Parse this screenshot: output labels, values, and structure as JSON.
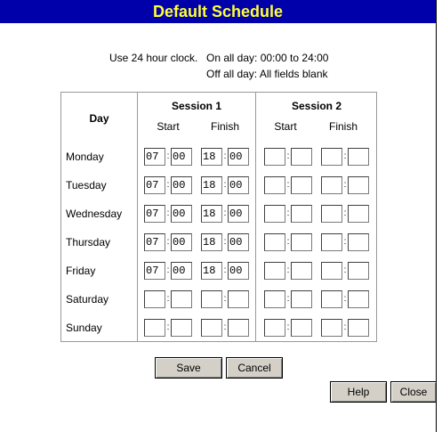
{
  "header": {
    "title": "Default Schedule"
  },
  "notes": {
    "use24": "Use 24 hour clock.",
    "on_all_day": "On all day: 00:00 to 24:00",
    "off_all_day": "Off all day: All fields blank"
  },
  "table": {
    "day_header": "Day",
    "session1": "Session 1",
    "session2": "Session 2",
    "start": "Start",
    "finish": "Finish",
    "rows": [
      {
        "day": "Monday",
        "s1_start_h": "07",
        "s1_start_m": "00",
        "s1_finish_h": "18",
        "s1_finish_m": "00",
        "s2_start_h": "",
        "s2_start_m": "",
        "s2_finish_h": "",
        "s2_finish_m": ""
      },
      {
        "day": "Tuesday",
        "s1_start_h": "07",
        "s1_start_m": "00",
        "s1_finish_h": "18",
        "s1_finish_m": "00",
        "s2_start_h": "",
        "s2_start_m": "",
        "s2_finish_h": "",
        "s2_finish_m": ""
      },
      {
        "day": "Wednesday",
        "s1_start_h": "07",
        "s1_start_m": "00",
        "s1_finish_h": "18",
        "s1_finish_m": "00",
        "s2_start_h": "",
        "s2_start_m": "",
        "s2_finish_h": "",
        "s2_finish_m": ""
      },
      {
        "day": "Thursday",
        "s1_start_h": "07",
        "s1_start_m": "00",
        "s1_finish_h": "18",
        "s1_finish_m": "00",
        "s2_start_h": "",
        "s2_start_m": "",
        "s2_finish_h": "",
        "s2_finish_m": ""
      },
      {
        "day": "Friday",
        "s1_start_h": "07",
        "s1_start_m": "00",
        "s1_finish_h": "18",
        "s1_finish_m": "00",
        "s2_start_h": "",
        "s2_start_m": "",
        "s2_finish_h": "",
        "s2_finish_m": ""
      },
      {
        "day": "Saturday",
        "s1_start_h": "",
        "s1_start_m": "",
        "s1_finish_h": "",
        "s1_finish_m": "",
        "s2_start_h": "",
        "s2_start_m": "",
        "s2_finish_h": "",
        "s2_finish_m": ""
      },
      {
        "day": "Sunday",
        "s1_start_h": "",
        "s1_start_m": "",
        "s1_finish_h": "",
        "s1_finish_m": "",
        "s2_start_h": "",
        "s2_start_m": "",
        "s2_finish_h": "",
        "s2_finish_m": ""
      }
    ]
  },
  "buttons": {
    "save": "Save",
    "cancel": "Cancel",
    "help": "Help",
    "close": "Close"
  },
  "colors": {
    "title_bg": "#0000aa",
    "title_fg": "#ffff33"
  }
}
